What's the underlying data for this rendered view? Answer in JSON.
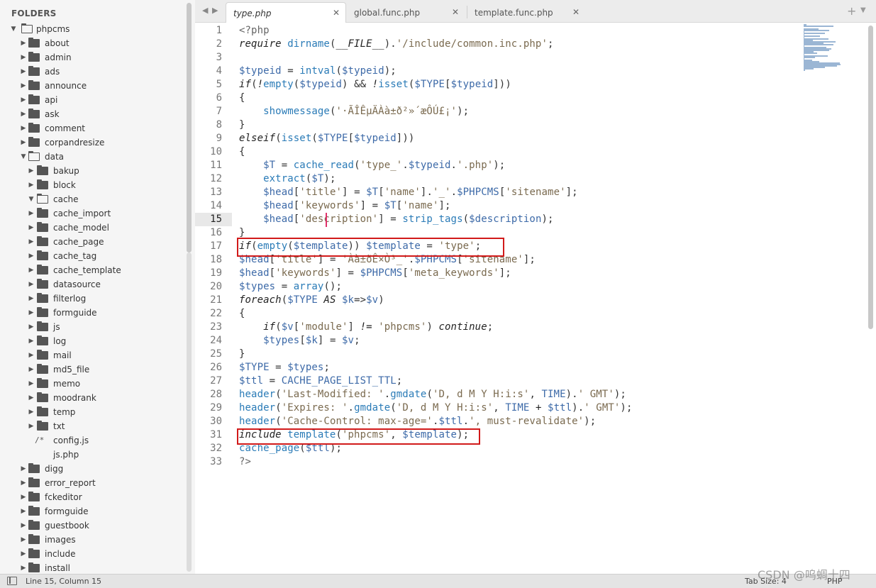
{
  "sidebar": {
    "title": "FOLDERS",
    "items": [
      {
        "label": "phpcms",
        "type": "folder",
        "open": true,
        "depth": 0
      },
      {
        "label": "about",
        "type": "folder",
        "open": false,
        "depth": 1
      },
      {
        "label": "admin",
        "type": "folder",
        "open": false,
        "depth": 1
      },
      {
        "label": "ads",
        "type": "folder",
        "open": false,
        "depth": 1
      },
      {
        "label": "announce",
        "type": "folder",
        "open": false,
        "depth": 1
      },
      {
        "label": "api",
        "type": "folder",
        "open": false,
        "depth": 1
      },
      {
        "label": "ask",
        "type": "folder",
        "open": false,
        "depth": 1
      },
      {
        "label": "comment",
        "type": "folder",
        "open": false,
        "depth": 1
      },
      {
        "label": "corpandresize",
        "type": "folder",
        "open": false,
        "depth": 1
      },
      {
        "label": "data",
        "type": "folder",
        "open": true,
        "depth": 1
      },
      {
        "label": "bakup",
        "type": "folder",
        "open": false,
        "depth": 2
      },
      {
        "label": "block",
        "type": "folder",
        "open": false,
        "depth": 2
      },
      {
        "label": "cache",
        "type": "folder",
        "open": true,
        "depth": 2
      },
      {
        "label": "cache_import",
        "type": "folder",
        "open": false,
        "depth": 2
      },
      {
        "label": "cache_model",
        "type": "folder",
        "open": false,
        "depth": 2
      },
      {
        "label": "cache_page",
        "type": "folder",
        "open": false,
        "depth": 2
      },
      {
        "label": "cache_tag",
        "type": "folder",
        "open": false,
        "depth": 2
      },
      {
        "label": "cache_template",
        "type": "folder",
        "open": false,
        "depth": 2
      },
      {
        "label": "datasource",
        "type": "folder",
        "open": false,
        "depth": 2
      },
      {
        "label": "filterlog",
        "type": "folder",
        "open": false,
        "depth": 2
      },
      {
        "label": "formguide",
        "type": "folder",
        "open": false,
        "depth": 2
      },
      {
        "label": "js",
        "type": "folder",
        "open": false,
        "depth": 2
      },
      {
        "label": "log",
        "type": "folder",
        "open": false,
        "depth": 2
      },
      {
        "label": "mail",
        "type": "folder",
        "open": false,
        "depth": 2
      },
      {
        "label": "md5_file",
        "type": "folder",
        "open": false,
        "depth": 2
      },
      {
        "label": "memo",
        "type": "folder",
        "open": false,
        "depth": 2
      },
      {
        "label": "moodrank",
        "type": "folder",
        "open": false,
        "depth": 2
      },
      {
        "label": "temp",
        "type": "folder",
        "open": false,
        "depth": 2
      },
      {
        "label": "txt",
        "type": "folder",
        "open": false,
        "depth": 2
      },
      {
        "label": "config.js",
        "type": "file-js",
        "depth": 2
      },
      {
        "label": "js.php",
        "type": "file",
        "depth": 2
      },
      {
        "label": "digg",
        "type": "folder",
        "open": false,
        "depth": 1
      },
      {
        "label": "error_report",
        "type": "folder",
        "open": false,
        "depth": 1
      },
      {
        "label": "fckeditor",
        "type": "folder",
        "open": false,
        "depth": 1
      },
      {
        "label": "formguide",
        "type": "folder",
        "open": false,
        "depth": 1
      },
      {
        "label": "guestbook",
        "type": "folder",
        "open": false,
        "depth": 1
      },
      {
        "label": "images",
        "type": "folder",
        "open": false,
        "depth": 1
      },
      {
        "label": "include",
        "type": "folder",
        "open": false,
        "depth": 1
      },
      {
        "label": "install",
        "type": "folder",
        "open": false,
        "depth": 1
      }
    ]
  },
  "tabs": [
    {
      "label": "type.php",
      "active": true
    },
    {
      "label": "global.func.php",
      "active": false
    },
    {
      "label": "template.func.php",
      "active": false
    }
  ],
  "editor": {
    "current_line": 15,
    "lines": [
      [
        [
          "c",
          "<?php"
        ]
      ],
      [
        [
          "k",
          "require"
        ],
        [
          "v",
          " "
        ],
        [
          "f",
          "dirname"
        ],
        [
          "v",
          "("
        ],
        [
          "k",
          "__FILE__"
        ],
        [
          "v",
          ")."
        ],
        [
          "s",
          "'/include/common.inc.php'"
        ],
        [
          "v",
          ";"
        ]
      ],
      [
        [
          "v",
          ""
        ]
      ],
      [
        [
          "d",
          "$typeid"
        ],
        [
          "v",
          " = "
        ],
        [
          "f",
          "intval"
        ],
        [
          "v",
          "("
        ],
        [
          "d",
          "$typeid"
        ],
        [
          "v",
          ");"
        ]
      ],
      [
        [
          "k",
          "if"
        ],
        [
          "v",
          "("
        ],
        [
          "k",
          "!"
        ],
        [
          "f",
          "empty"
        ],
        [
          "v",
          "("
        ],
        [
          "d",
          "$typeid"
        ],
        [
          "v",
          ") && "
        ],
        [
          "k",
          "!"
        ],
        [
          "f",
          "isset"
        ],
        [
          "v",
          "("
        ],
        [
          "d",
          "$TYPE"
        ],
        [
          "v",
          "["
        ],
        [
          "d",
          "$typeid"
        ],
        [
          "v",
          "]))"
        ]
      ],
      [
        [
          "v",
          "{"
        ]
      ],
      [
        [
          "v",
          "    "
        ],
        [
          "f",
          "showmessage"
        ],
        [
          "v",
          "("
        ],
        [
          "s",
          "'·ÃÎÊµÄÀà±ð²»´æÔÚ£¡'"
        ],
        [
          "v",
          ");"
        ]
      ],
      [
        [
          "v",
          "}"
        ]
      ],
      [
        [
          "k",
          "elseif"
        ],
        [
          "v",
          "("
        ],
        [
          "f",
          "isset"
        ],
        [
          "v",
          "("
        ],
        [
          "d",
          "$TYPE"
        ],
        [
          "v",
          "["
        ],
        [
          "d",
          "$typeid"
        ],
        [
          "v",
          "]))"
        ]
      ],
      [
        [
          "v",
          "{"
        ]
      ],
      [
        [
          "v",
          "    "
        ],
        [
          "d",
          "$T"
        ],
        [
          "v",
          " = "
        ],
        [
          "f",
          "cache_read"
        ],
        [
          "v",
          "("
        ],
        [
          "s",
          "'type_'"
        ],
        [
          "v",
          "."
        ],
        [
          "d",
          "$typeid"
        ],
        [
          "v",
          "."
        ],
        [
          "s",
          "'.php'"
        ],
        [
          "v",
          ");"
        ]
      ],
      [
        [
          "v",
          "    "
        ],
        [
          "f",
          "extract"
        ],
        [
          "v",
          "("
        ],
        [
          "d",
          "$T"
        ],
        [
          "v",
          ");"
        ]
      ],
      [
        [
          "v",
          "    "
        ],
        [
          "d",
          "$head"
        ],
        [
          "v",
          "["
        ],
        [
          "s",
          "'title'"
        ],
        [
          "v",
          "] = "
        ],
        [
          "d",
          "$T"
        ],
        [
          "v",
          "["
        ],
        [
          "s",
          "'name'"
        ],
        [
          "v",
          "]."
        ],
        [
          "s",
          "'_'"
        ],
        [
          "v",
          "."
        ],
        [
          "d",
          "$PHPCMS"
        ],
        [
          "v",
          "["
        ],
        [
          "s",
          "'sitename'"
        ],
        [
          "v",
          "];"
        ]
      ],
      [
        [
          "v",
          "    "
        ],
        [
          "d",
          "$head"
        ],
        [
          "v",
          "["
        ],
        [
          "s",
          "'keywords'"
        ],
        [
          "v",
          "] = "
        ],
        [
          "d",
          "$T"
        ],
        [
          "v",
          "["
        ],
        [
          "s",
          "'name'"
        ],
        [
          "v",
          "];"
        ]
      ],
      [
        [
          "v",
          "    "
        ],
        [
          "d",
          "$head"
        ],
        [
          "v",
          "["
        ],
        [
          "s",
          "'description'"
        ],
        [
          "v",
          "] = "
        ],
        [
          "f",
          "strip_tags"
        ],
        [
          "v",
          "("
        ],
        [
          "d",
          "$description"
        ],
        [
          "v",
          ");"
        ]
      ],
      [
        [
          "v",
          "}"
        ]
      ],
      [
        [
          "k",
          "if"
        ],
        [
          "v",
          "("
        ],
        [
          "f",
          "empty"
        ],
        [
          "v",
          "("
        ],
        [
          "d",
          "$template"
        ],
        [
          "v",
          ")) "
        ],
        [
          "d",
          "$template"
        ],
        [
          "v",
          " = "
        ],
        [
          "s",
          "'type'"
        ],
        [
          "v",
          ";"
        ]
      ],
      [
        [
          "d",
          "$head"
        ],
        [
          "v",
          "["
        ],
        [
          "s",
          "'title'"
        ],
        [
          "v",
          "] = "
        ],
        [
          "s",
          "'Àà±ðÊ×Ò³_'"
        ],
        [
          "v",
          "."
        ],
        [
          "d",
          "$PHPCMS"
        ],
        [
          "v",
          "["
        ],
        [
          "s",
          "'sitename'"
        ],
        [
          "v",
          "];"
        ]
      ],
      [
        [
          "d",
          "$head"
        ],
        [
          "v",
          "["
        ],
        [
          "s",
          "'keywords'"
        ],
        [
          "v",
          "] = "
        ],
        [
          "d",
          "$PHPCMS"
        ],
        [
          "v",
          "["
        ],
        [
          "s",
          "'meta_keywords'"
        ],
        [
          "v",
          "];"
        ]
      ],
      [
        [
          "d",
          "$types"
        ],
        [
          "v",
          " = "
        ],
        [
          "f",
          "array"
        ],
        [
          "v",
          "();"
        ]
      ],
      [
        [
          "k",
          "foreach"
        ],
        [
          "v",
          "("
        ],
        [
          "d",
          "$TYPE"
        ],
        [
          "v",
          " "
        ],
        [
          "k",
          "AS"
        ],
        [
          "v",
          " "
        ],
        [
          "d",
          "$k"
        ],
        [
          "v",
          "=>"
        ],
        [
          "d",
          "$v"
        ],
        [
          "v",
          ")"
        ]
      ],
      [
        [
          "v",
          "{"
        ]
      ],
      [
        [
          "v",
          "    "
        ],
        [
          "k",
          "if"
        ],
        [
          "v",
          "("
        ],
        [
          "d",
          "$v"
        ],
        [
          "v",
          "["
        ],
        [
          "s",
          "'module'"
        ],
        [
          "v",
          "] "
        ],
        [
          "k",
          "!="
        ],
        [
          "v",
          " "
        ],
        [
          "s",
          "'phpcms'"
        ],
        [
          "v",
          ") "
        ],
        [
          "k",
          "continue"
        ],
        [
          "v",
          ";"
        ]
      ],
      [
        [
          "v",
          "    "
        ],
        [
          "d",
          "$types"
        ],
        [
          "v",
          "["
        ],
        [
          "d",
          "$k"
        ],
        [
          "v",
          "] = "
        ],
        [
          "d",
          "$v"
        ],
        [
          "v",
          ";"
        ]
      ],
      [
        [
          "v",
          "}"
        ]
      ],
      [
        [
          "d",
          "$TYPE"
        ],
        [
          "v",
          " = "
        ],
        [
          "d",
          "$types"
        ],
        [
          "v",
          ";"
        ]
      ],
      [
        [
          "d",
          "$ttl"
        ],
        [
          "v",
          " = "
        ],
        [
          "d",
          "CACHE_PAGE_LIST_TTL"
        ],
        [
          "v",
          ";"
        ]
      ],
      [
        [
          "f",
          "header"
        ],
        [
          "v",
          "("
        ],
        [
          "s",
          "'Last-Modified: '"
        ],
        [
          "v",
          "."
        ],
        [
          "f",
          "gmdate"
        ],
        [
          "v",
          "("
        ],
        [
          "s",
          "'D, d M Y H:i:s'"
        ],
        [
          "v",
          ", "
        ],
        [
          "d",
          "TIME"
        ],
        [
          "v",
          ")."
        ],
        [
          "s",
          "' GMT'"
        ],
        [
          "v",
          ");"
        ]
      ],
      [
        [
          "f",
          "header"
        ],
        [
          "v",
          "("
        ],
        [
          "s",
          "'Expires: '"
        ],
        [
          "v",
          "."
        ],
        [
          "f",
          "gmdate"
        ],
        [
          "v",
          "("
        ],
        [
          "s",
          "'D, d M Y H:i:s'"
        ],
        [
          "v",
          ", "
        ],
        [
          "d",
          "TIME"
        ],
        [
          "v",
          " "
        ],
        [
          "k",
          "+"
        ],
        [
          "v",
          " "
        ],
        [
          "d",
          "$ttl"
        ],
        [
          "v",
          ")."
        ],
        [
          "s",
          "' GMT'"
        ],
        [
          "v",
          ");"
        ]
      ],
      [
        [
          "f",
          "header"
        ],
        [
          "v",
          "("
        ],
        [
          "s",
          "'Cache-Control: max-age='"
        ],
        [
          "v",
          "."
        ],
        [
          "d",
          "$ttl"
        ],
        [
          "v",
          "."
        ],
        [
          "s",
          "', must-revalidate'"
        ],
        [
          "v",
          ");"
        ]
      ],
      [
        [
          "k",
          "include"
        ],
        [
          "v",
          " "
        ],
        [
          "f",
          "template"
        ],
        [
          "v",
          "("
        ],
        [
          "s",
          "'phpcms'"
        ],
        [
          "v",
          ", "
        ],
        [
          "d",
          "$template"
        ],
        [
          "v",
          ");"
        ]
      ],
      [
        [
          "f",
          "cache_page"
        ],
        [
          "v",
          "("
        ],
        [
          "d",
          "$ttl"
        ],
        [
          "v",
          ");"
        ]
      ],
      [
        [
          "c",
          "?>"
        ]
      ]
    ]
  },
  "status": {
    "position": "Line 15, Column 15",
    "tab_size": "Tab Size: 4",
    "syntax": "PHP"
  },
  "watermark": "CSDN @呜蜩十四",
  "colors": {
    "highlight_box": "#d11a1a",
    "function": "#2a7bb7",
    "variable": "#3d6aa8",
    "string": "#7a6a4f"
  }
}
